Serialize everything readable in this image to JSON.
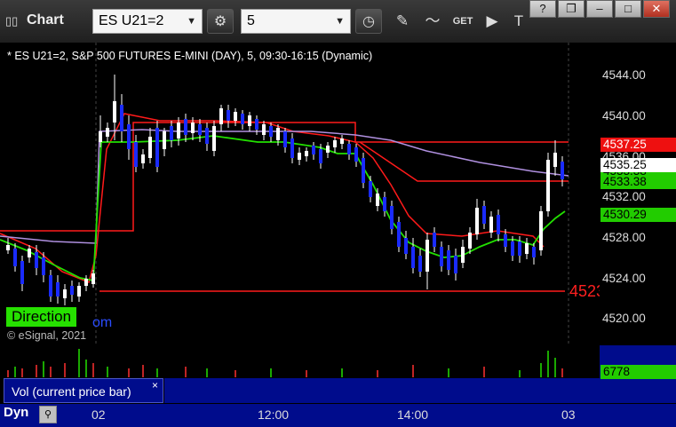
{
  "window": {
    "title": "Chart",
    "controls": {
      "help": "?",
      "restore": "❐",
      "minimize": "–",
      "maximize": "□",
      "close": "✕"
    }
  },
  "toolbar": {
    "symbol": "ES U21=2",
    "interval": "5",
    "icons": [
      "gear-icon",
      "clock-icon",
      "pencil-icon",
      "study-icon",
      "get-icon",
      "play-icon",
      "text-icon"
    ]
  },
  "chart": {
    "header": "* ES U21=2, S&P 500 FUTURES E-MINI (DAY), 5, 09:30-16:15 (Dynamic)",
    "copyright": "© eSignal, 2021",
    "direction_badge": "Direction",
    "direction_suffix": "om",
    "level_label": "4523",
    "price_ticks": [
      "4544.00",
      "4540.00",
      "4536.00",
      "4532.00",
      "4528.00",
      "4524.00",
      "4520.00"
    ],
    "price_tags": [
      {
        "text": "4537.25",
        "bg": "#ee1010",
        "fg": "#ffffff"
      },
      {
        "text": "4535.25",
        "bg": "#ffffff",
        "fg": "#000000"
      },
      {
        "text": "4533.38",
        "bg": "#22cc00",
        "fg": "#000000"
      },
      {
        "text": "4530.29",
        "bg": "#22cc00",
        "fg": "#000000"
      }
    ],
    "hidden_tag": "4533.38",
    "colors": {
      "up_candle": "#ffffff",
      "down_candle": "#1a2bff",
      "ma_fast": "#22e000",
      "ma_red": "#ff1a1a",
      "ma_purple": "#b090e0",
      "level_line": "#ff1a1a"
    }
  },
  "volume": {
    "legend": "Vol (current price bar)",
    "close": "×",
    "value_tag": "6778",
    "value_tag_bg": "#22cc00"
  },
  "time_axis": {
    "tab": "Dyn",
    "labels": [
      "02",
      "12:00",
      "14:00",
      "03"
    ]
  }
}
